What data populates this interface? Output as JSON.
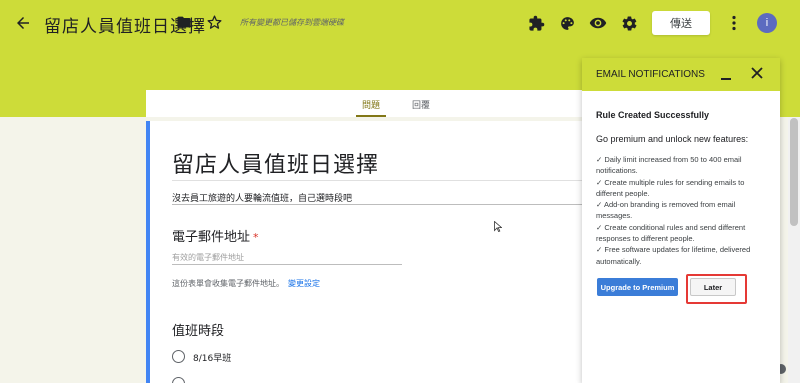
{
  "header": {
    "title": "留店人員值班日選擇",
    "save_status": "所有變更都已儲存到雲端硬碟",
    "send_label": "傳送",
    "avatar_letter": "i",
    "icons": [
      "back-arrow-icon",
      "folder-icon",
      "star-icon",
      "puzzle-icon",
      "palette-icon",
      "eye-icon",
      "gear-icon",
      "more-vert-icon"
    ]
  },
  "tabs": {
    "questions": "問題",
    "responses": "回覆"
  },
  "form": {
    "title": "留店人員值班日選擇",
    "description": "沒去員工旅遊的人要輪流值班，自己選時段吧",
    "email_question": "電子郵件地址",
    "required_mark": "*",
    "email_placeholder": "有效的電子郵件地址",
    "email_note": "這份表單會收集電子郵件地址。",
    "email_note_link": "變更設定",
    "shift_question": "值班時段",
    "option_1": "8/16早班"
  },
  "panel": {
    "title": "EMAIL NOTIFICATIONS",
    "heading": "Rule Created Successfully",
    "intro": "Go premium and unlock new features:",
    "features": [
      "✓ Daily limit increased from 50 to 400 email notifications.",
      "✓ Create multiple rules for sending emails to different people.",
      "✓ Add-on branding is removed from email messages.",
      "✓ Create conditional rules and send different responses to different people.",
      "✓ Free software updates for lifetime, delivered automatically."
    ],
    "upgrade_label": "Upgrade to Premium",
    "later_label": "Later"
  },
  "colors": {
    "theme": "#cddc39",
    "accent_tab": "#827717",
    "form_border": "#4285f4",
    "upgrade": "#3b7dd8",
    "highlight": "#e53935",
    "avatar": "#5c6bc0"
  }
}
